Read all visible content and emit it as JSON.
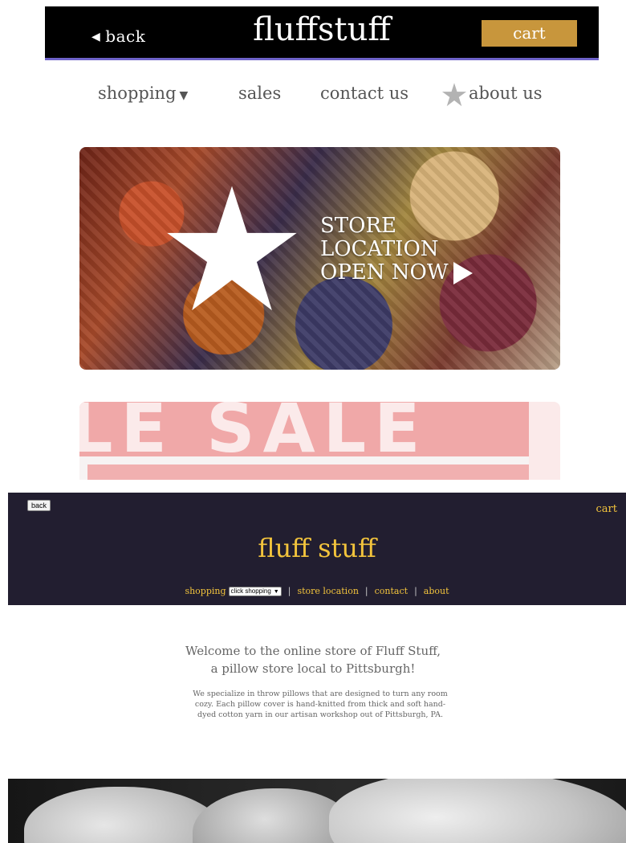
{
  "mockup1": {
    "header": {
      "back_label": "back",
      "logo": "fluffstuff",
      "cart_label": "cart"
    },
    "nav": {
      "items": [
        {
          "label": "shopping"
        },
        {
          "label": "sales"
        },
        {
          "label": "contact us"
        },
        {
          "label": "about us"
        }
      ]
    },
    "hero": {
      "lines": [
        "STORE",
        "LOCATION",
        "OPEN NOW"
      ]
    },
    "sale_banner": {
      "text": "LE SALE"
    }
  },
  "mockup2": {
    "header": {
      "back_label": "back",
      "cart_label": "cart",
      "logo": "fluff stuff"
    },
    "nav": {
      "shopping_label": "shopping",
      "select_value": "click shopping",
      "items": [
        {
          "label": "store location"
        },
        {
          "label": "contact"
        },
        {
          "label": "about"
        }
      ]
    },
    "welcome": {
      "line1": "Welcome to the online store of Fluff Stuff,",
      "line2": "a pillow store local to Pittsburgh!"
    },
    "paragraph": "We specialize in throw pillows that are designed to turn any room cozy. Each pillow cover is hand-knitted from thick and soft hand-dyed cotton yarn in our artisan workshop out of Pittsburgh, PA."
  },
  "colors": {
    "mockup1_header_bg": "#000000",
    "mockup1_header_border": "#6f63c9",
    "mockup1_cart_bg": "#c8963c",
    "mockup2_header_bg": "#221e30",
    "mockup2_accent": "#f3c43c",
    "body_text": "#666666"
  },
  "icons": {
    "back": "left-triangle-icon",
    "dropdown": "caret-down-icon",
    "about": "star-icon",
    "hero_star": "star-icon",
    "hero_play": "play-icon"
  }
}
